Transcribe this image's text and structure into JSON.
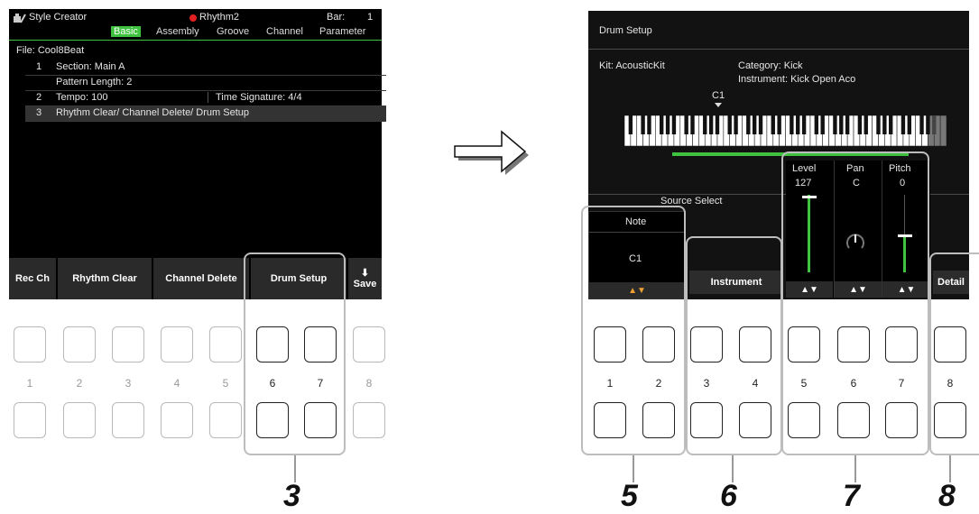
{
  "left_screen": {
    "app_title": "Style Creator",
    "style_name": "Rhythm2",
    "bar_label": "Bar:",
    "bar_value": "1",
    "tabs": [
      "Basic",
      "Assembly",
      "Groove",
      "Channel",
      "Parameter"
    ],
    "active_tab": "Basic",
    "file_line": "File: Cool8Beat",
    "rows": [
      {
        "num": "1",
        "text": "Section: Main A"
      },
      {
        "num": "",
        "text": "Pattern Length: 2"
      },
      {
        "num": "2",
        "text": "Tempo: 100",
        "extra": "Time Signature: 4/4"
      },
      {
        "num": "3",
        "text": "Rhythm Clear/ Channel Delete/ Drum Setup"
      }
    ],
    "buttons": [
      "Rec Ch",
      "Rhythm Clear",
      "Channel Delete",
      "Drum Setup",
      "Save"
    ]
  },
  "left_hw_numbers": [
    "1",
    "2",
    "3",
    "4",
    "5",
    "6",
    "7",
    "8"
  ],
  "left_step": "3",
  "right_screen": {
    "title": "Drum Setup",
    "kit_line": "Kit: AcousticKit",
    "category_line": "Category: Kick",
    "instrument_line": "Instrument: Kick Open Aco",
    "key_marker": "C1",
    "source_select": "Source Select",
    "note_label": "Note",
    "note_value": "C1",
    "instrument_button": "Instrument",
    "level_label": "Level",
    "level_value": "127",
    "pan_label": "Pan",
    "pan_value": "C",
    "pitch_label": "Pitch",
    "pitch_value": "0",
    "detail_button": "Detail",
    "updown": "▲▼"
  },
  "right_hw_numbers": [
    "1",
    "2",
    "3",
    "4",
    "5",
    "6",
    "7",
    "8"
  ],
  "right_steps": [
    "5",
    "6",
    "7",
    "8"
  ],
  "colors": {
    "accent_green": "#3fc23f",
    "note_arrow": "#f0a030",
    "record_dot": "#e02020"
  }
}
